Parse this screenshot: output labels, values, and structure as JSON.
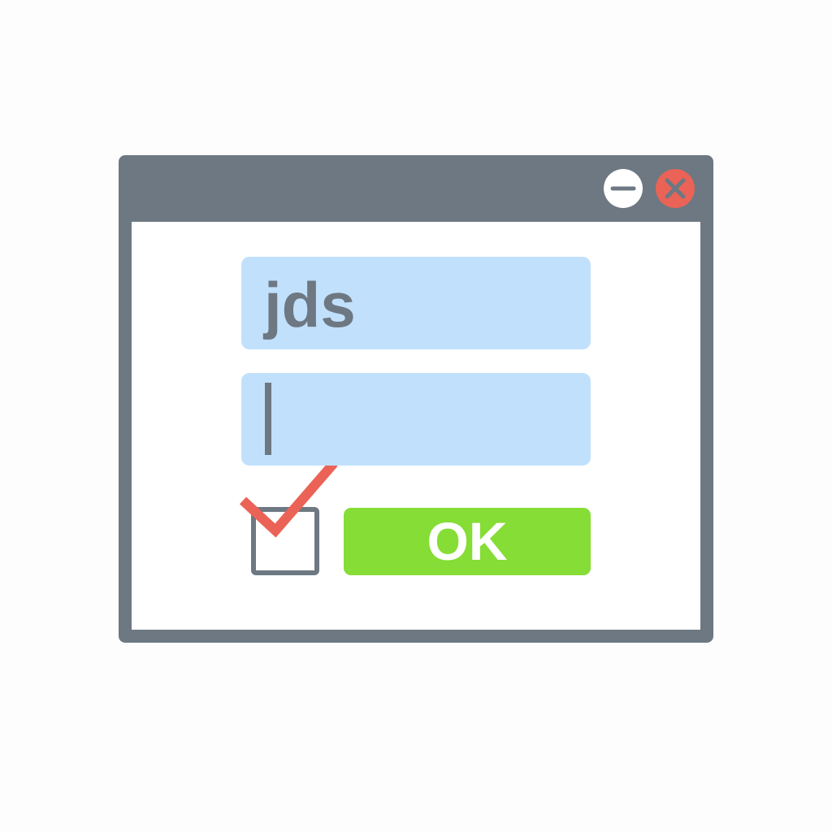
{
  "window": {
    "titlebar_color": "#6d7882",
    "controls": [
      {
        "icon": "minimize-icon",
        "color": "#ffffff"
      },
      {
        "icon": "close-icon",
        "color": "#ea6356"
      }
    ]
  },
  "form": {
    "username": {
      "value": "jds",
      "background": "#c1e0fc"
    },
    "password": {
      "value": "",
      "focused": true
    },
    "checkbox": {
      "checked": true,
      "check_color": "#ea6356"
    },
    "ok_button": {
      "label": "OK",
      "color": "#85dd35"
    }
  }
}
